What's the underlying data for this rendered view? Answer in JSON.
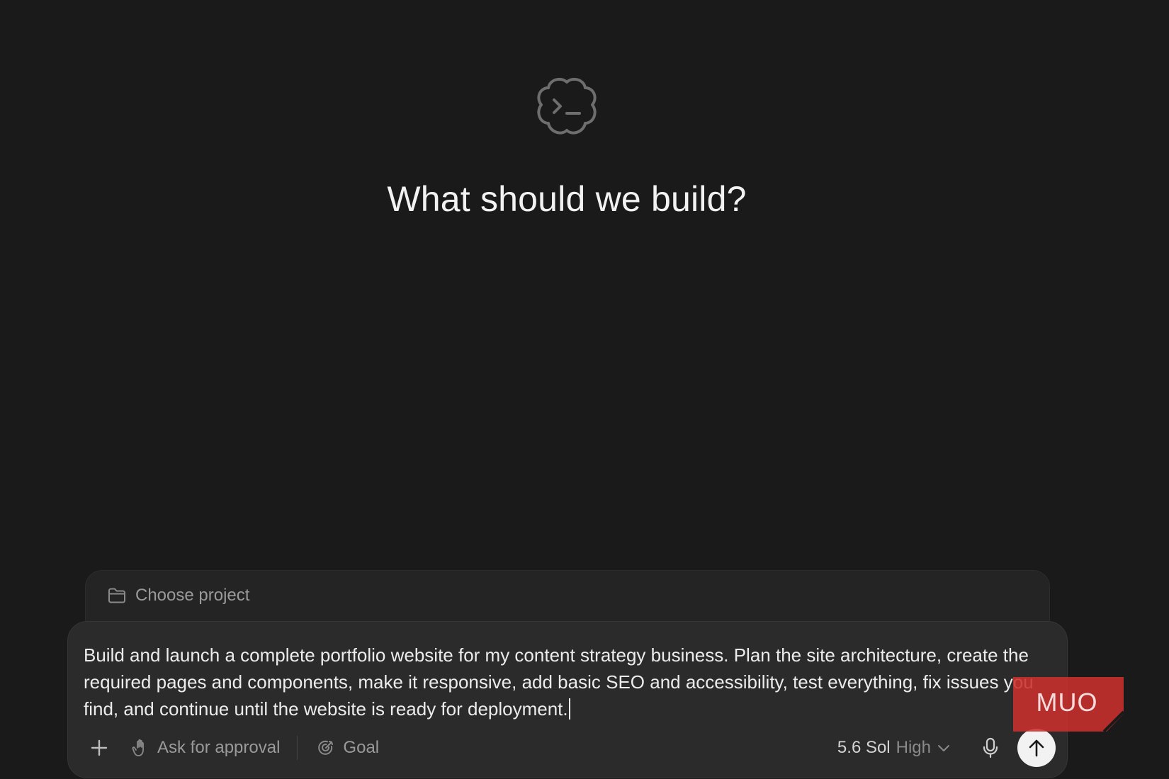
{
  "hero": {
    "logo_icon": "terminal-cloud-logo-icon",
    "title": "What should we build?"
  },
  "project": {
    "icon": "folder-icon",
    "label": "Choose project"
  },
  "composer": {
    "prompt_text": "Build and launch a complete portfolio website for my content strategy business. Plan the site architecture, create the required pages and components, make it responsive, add basic SEO and accessibility, test everything, fix issues you find, and continue until the website is ready for deployment.",
    "toolbar": {
      "add_icon": "plus-icon",
      "approval_icon": "hand-icon",
      "approval_label": "Ask for approval",
      "goal_icon": "goal-target-icon",
      "goal_label": "Goal",
      "model_name": "5.6 Sol",
      "model_effort": "High",
      "model_chevron_icon": "chevron-down-icon",
      "mic_icon": "microphone-icon",
      "send_icon": "arrow-up-icon"
    }
  },
  "watermark": {
    "text": "MUO",
    "color": "#d0312d"
  },
  "colors": {
    "background": "#1a1a1a",
    "composer": "#2b2b2b",
    "project_bar": "#242424",
    "send_button": "#f2f2f2"
  }
}
